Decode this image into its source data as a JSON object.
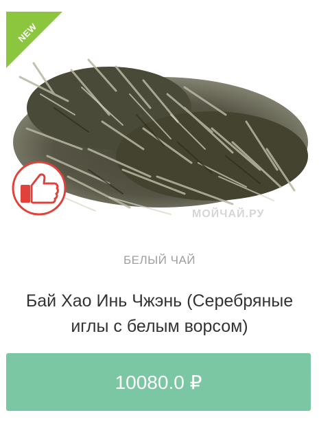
{
  "product": {
    "badge_new": "NEW",
    "watermark": "МОЙЧАЙ.РУ",
    "category": "БЕЛЫЙ ЧАЙ",
    "title_line1": "Бай Хао Инь Чжэнь (Серебряные",
    "title_line2": "иглы с белым ворсом)",
    "price": "10080.0 ₽",
    "image_icon": "tea-leaves-photo",
    "like_icon": "thumbs-up-icon"
  },
  "colors": {
    "accent_green": "#7bc7a3",
    "ribbon_green": "#8cc63f",
    "like_red": "#e0413a"
  }
}
